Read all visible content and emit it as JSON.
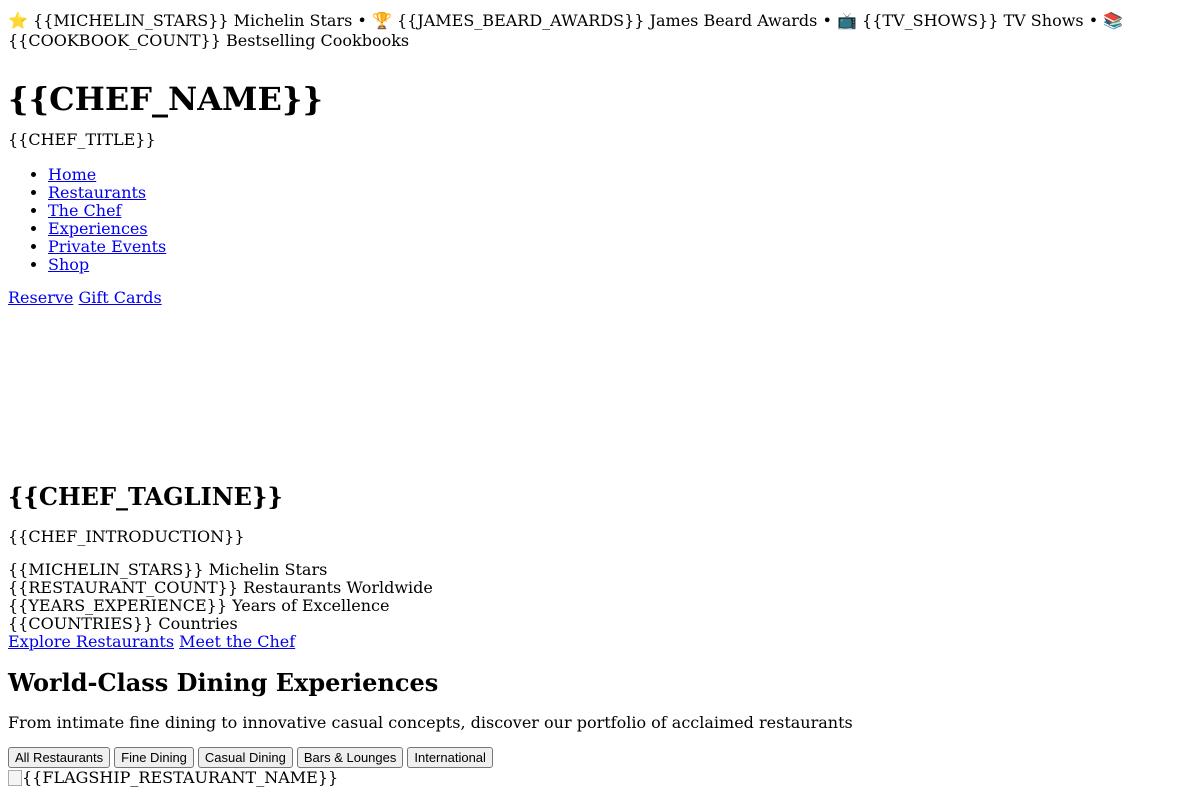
{
  "topbar": {
    "star_emoji": "⭐",
    "michelin_text": "{{MICHELIN_STARS}} Michelin Stars",
    "trophy_emoji": "🏆",
    "beard_text": "{{JAMES_BEARD_AWARDS}} James Beard Awards",
    "tv_emoji": "📺",
    "tv_text": "{{TV_SHOWS}} TV Shows",
    "book_emoji": "📚",
    "book_text": "{{COOKBOOK_COUNT}} Bestselling Cookbooks",
    "separator": "•"
  },
  "header": {
    "chef_name": "{{CHEF_NAME}}",
    "chef_title": "{{CHEF_TITLE}}"
  },
  "nav": {
    "items": [
      {
        "label": "Home"
      },
      {
        "label": "Restaurants"
      },
      {
        "label": "The Chef"
      },
      {
        "label": "Experiences"
      },
      {
        "label": "Private Events"
      },
      {
        "label": "Shop"
      }
    ]
  },
  "actions": {
    "reserve": "Reserve",
    "gift_cards": "Gift Cards"
  },
  "hero": {
    "tagline": "{{CHEF_TAGLINE}}",
    "introduction": "{{CHEF_INTRODUCTION}}",
    "stats": [
      {
        "text": "{{MICHELIN_STARS}} Michelin Stars"
      },
      {
        "text": "{{RESTAURANT_COUNT}} Restaurants Worldwide"
      },
      {
        "text": "{{YEARS_EXPERIENCE}} Years of Excellence"
      },
      {
        "text": "{{COUNTRIES}} Countries"
      }
    ],
    "explore_label": "Explore Restaurants",
    "meet_label": "Meet the Chef"
  },
  "dining": {
    "heading": "World-Class Dining Experiences",
    "subheading": "From intimate fine dining to innovative casual concepts, discover our portfolio of acclaimed restaurants",
    "filters": [
      {
        "label": "All Restaurants"
      },
      {
        "label": "Fine Dining"
      },
      {
        "label": "Casual Dining"
      },
      {
        "label": "Bars & Lounges"
      },
      {
        "label": "International"
      }
    ],
    "flagship_alt": "{{FLAGSHIP_RESTAURANT_NAME}}"
  }
}
